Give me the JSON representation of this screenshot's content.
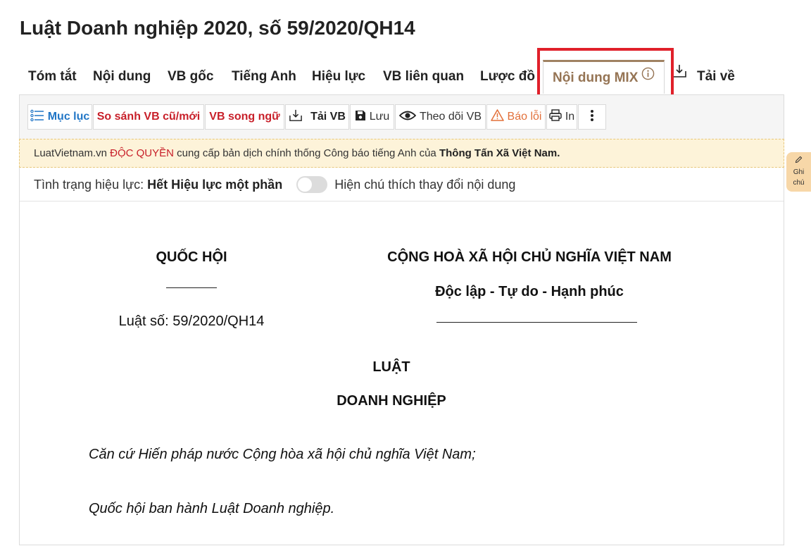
{
  "page": {
    "title": "Luật Doanh nghiệp 2020, số 59/2020/QH14"
  },
  "tabs": [
    {
      "label": "Tóm tắt"
    },
    {
      "label": "Nội dung"
    },
    {
      "label": "VB gốc"
    },
    {
      "label": "Tiếng Anh"
    },
    {
      "label": "Hiệu lực"
    },
    {
      "label": "VB liên quan"
    },
    {
      "label": "Lược đồ"
    },
    {
      "label": "Nội dung MIX",
      "active": true
    },
    {
      "label": "Tải về"
    }
  ],
  "toolbar": {
    "muc_luc": "Mục lục",
    "so_sanh": "So sánh VB cũ/mới",
    "song_ngu": "VB song ngữ",
    "tai_vb": "Tải VB",
    "luu": "Lưu",
    "theo_doi": "Theo dõi VB",
    "bao_loi": "Báo lỗi",
    "in": "In"
  },
  "banner": {
    "site": "LuatVietnam.vn",
    "exclusive": "ĐỘC QUYỀN",
    "middle": "cung cấp bản dịch chính thống Công báo tiếng Anh của",
    "agency": "Thông Tấn Xã Việt Nam."
  },
  "status": {
    "label": "Tình trạng hiệu lực:",
    "value": "Hết Hiệu lực một phần",
    "toggle_label": "Hiện chú thích thay đổi nội dung",
    "toggle_on": false
  },
  "document": {
    "issuer": "QUỐC HỘI",
    "number": "Luật số: 59/2020/QH14",
    "country": "CỘNG HOÀ XÃ HỘI CHỦ NGHĨA VIỆT NAM",
    "motto": "Độc lập - Tự do - Hạnh phúc",
    "doc_type": "LUẬT",
    "doc_name": "DOANH NGHIỆP",
    "preamble_1": "Căn cứ Hiến pháp nước Cộng hòa xã hội chủ nghĩa Việt Nam;",
    "preamble_2": "Quốc hội ban hành Luật Doanh nghiệp."
  },
  "note_tab": {
    "line1": "Ghi",
    "line2": "chú"
  },
  "colors": {
    "highlight": "#e0202a",
    "active_tab": "#957454",
    "blue": "#2176c6",
    "red": "#c8202a",
    "banner_bg": "#fdf3d9",
    "note_bg": "#f7d7a8"
  }
}
